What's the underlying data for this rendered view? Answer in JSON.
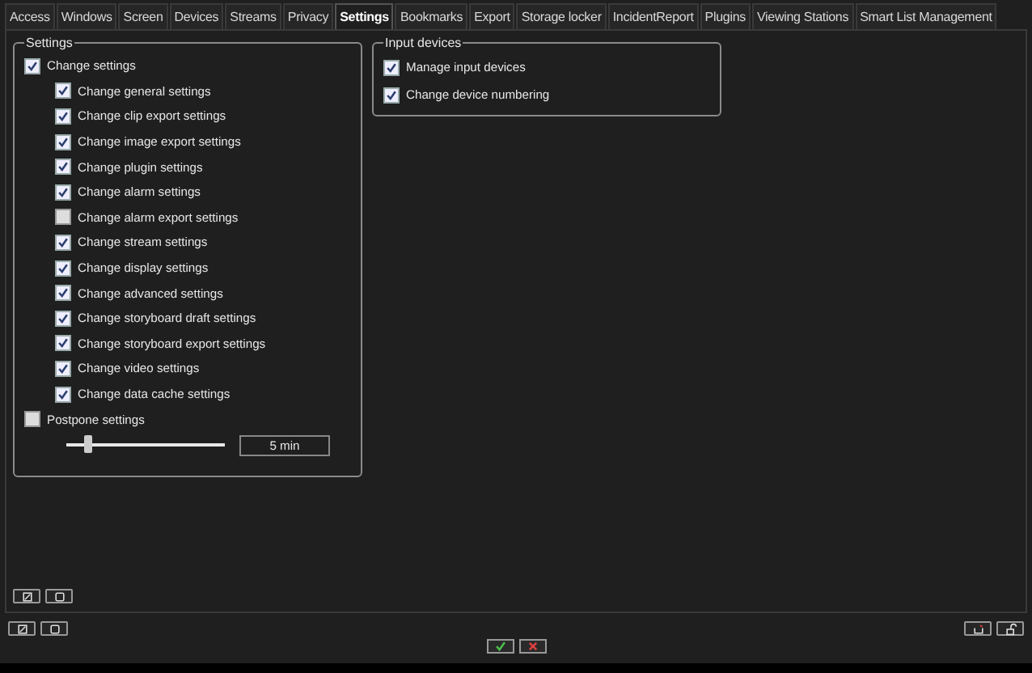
{
  "tabs": [
    {
      "label": "Access",
      "selected": false
    },
    {
      "label": "Windows",
      "selected": false
    },
    {
      "label": "Screen",
      "selected": false
    },
    {
      "label": "Devices",
      "selected": false
    },
    {
      "label": "Streams",
      "selected": false
    },
    {
      "label": "Privacy",
      "selected": false
    },
    {
      "label": "Settings",
      "selected": true
    },
    {
      "label": "Bookmarks",
      "selected": false
    },
    {
      "label": "Export",
      "selected": false
    },
    {
      "label": "Storage locker",
      "selected": false
    },
    {
      "label": "IncidentReport",
      "selected": false
    },
    {
      "label": "Plugins",
      "selected": false
    },
    {
      "label": "Viewing Stations",
      "selected": false
    },
    {
      "label": "Smart List Management",
      "selected": false
    }
  ],
  "settings_group": {
    "title": "Settings",
    "master": {
      "label": "Change settings",
      "checked": true
    },
    "items": [
      {
        "label": "Change general settings",
        "checked": true
      },
      {
        "label": "Change clip export settings",
        "checked": true
      },
      {
        "label": "Change image export settings",
        "checked": true
      },
      {
        "label": "Change plugin settings",
        "checked": true
      },
      {
        "label": "Change alarm settings",
        "checked": true
      },
      {
        "label": "Change alarm export settings",
        "checked": false
      },
      {
        "label": "Change stream settings",
        "checked": true
      },
      {
        "label": "Change display settings",
        "checked": true
      },
      {
        "label": "Change advanced settings",
        "checked": true
      },
      {
        "label": "Change storyboard draft settings",
        "checked": true
      },
      {
        "label": "Change storyboard export settings",
        "checked": true
      },
      {
        "label": "Change video settings",
        "checked": true
      },
      {
        "label": "Change data cache settings",
        "checked": true
      }
    ],
    "postpone": {
      "label": "Postpone settings",
      "checked": false
    },
    "slider": {
      "level": 0.13
    },
    "duration": "5 min"
  },
  "input_group": {
    "title": "Input devices",
    "items": [
      {
        "label": "Manage input devices",
        "checked": true
      },
      {
        "label": "Change device numbering",
        "checked": true
      }
    ]
  }
}
